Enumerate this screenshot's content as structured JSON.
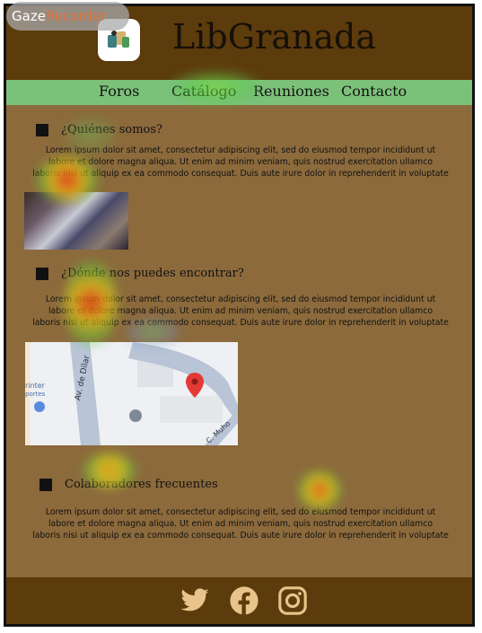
{
  "watermark": {
    "gaze": "Gaze",
    "recorder": "Recorder"
  },
  "header": {
    "title": "LibGranada",
    "logo_icon": "book-icon"
  },
  "nav": [
    "Foros",
    "Catálogo",
    "Reuniones",
    "Contacto"
  ],
  "sections": [
    {
      "heading": "¿Quiénes somos?"
    },
    {
      "heading": "¿Dónde nos puedes encontrar?"
    },
    {
      "heading": "Colaboradores frecuentes"
    }
  ],
  "lorem": {
    "line1": "Lorem ipsum dolor sit amet, consectetur adipiscing elit, sed do eiusmod tempor incididunt ut",
    "line2": "labore et dolore magna aliqua. Ut enim ad minim veniam, quis nostrud exercitation ullamco",
    "line3": "laboris nisi ut aliquip ex ea commodo consequat. Duis aute irure dolor in reprehenderit in voluptate"
  },
  "map": {
    "street1": "Av. de Dílar",
    "street2": "C. Muho",
    "poi1": "rinter",
    "poi2": "portes"
  },
  "social": [
    "twitter-icon",
    "facebook-icon",
    "instagram-icon"
  ],
  "colors": {
    "header_bg": "#5c3b0c",
    "page_bg": "#8c6a3c",
    "nav_bg": "#7cc17a"
  }
}
